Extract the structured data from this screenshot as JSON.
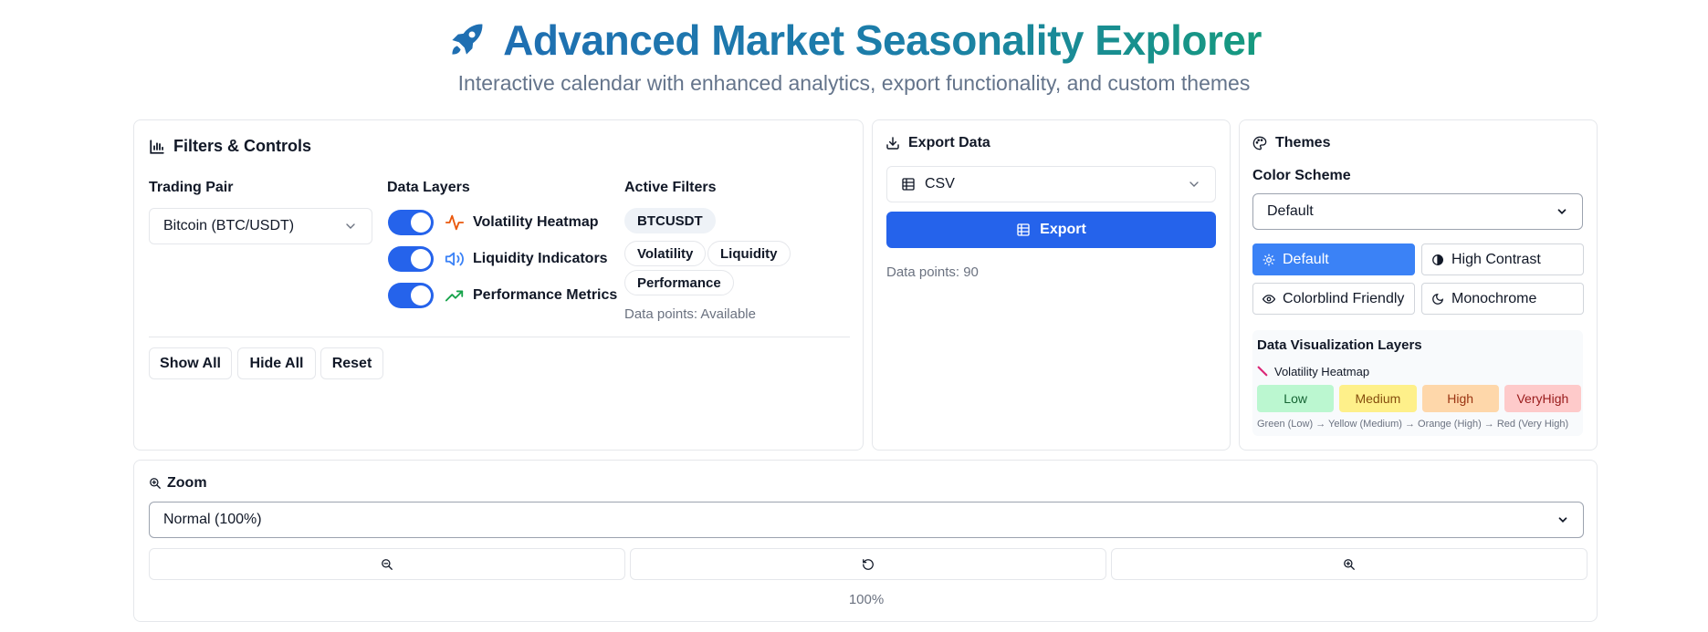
{
  "header": {
    "title": "Advanced Market Seasonality Explorer",
    "subtitle": "Interactive calendar with enhanced analytics, export functionality, and custom themes",
    "icon": "rocket-icon"
  },
  "filters": {
    "title": "Filters & Controls",
    "trading_pair_label": "Trading Pair",
    "trading_pair_value": "Bitcoin (BTC/USDT)",
    "data_layers_label": "Data Layers",
    "layers": [
      {
        "label": "Volatility Heatmap",
        "icon": "activity-icon",
        "on": true
      },
      {
        "label": "Liquidity Indicators",
        "icon": "volume-icon",
        "on": true
      },
      {
        "label": "Performance Metrics",
        "icon": "trending-up-icon",
        "on": true
      }
    ],
    "active_filters_label": "Active Filters",
    "active_symbol": "BTCUSDT",
    "active_tags": [
      "Volatility",
      "Liquidity",
      "Performance"
    ],
    "data_points_status": "Data points: Available",
    "buttons": {
      "show_all": "Show All",
      "hide_all": "Hide All",
      "reset": "Reset"
    }
  },
  "export": {
    "title": "Export Data",
    "format": "CSV",
    "button": "Export",
    "data_points": "Data points: 90"
  },
  "themes": {
    "title": "Themes",
    "color_scheme_label": "Color Scheme",
    "color_scheme_value": "Default",
    "options": [
      {
        "label": "Default",
        "icon": "sun-icon",
        "active": true
      },
      {
        "label": "High Contrast",
        "icon": "contrast-icon",
        "active": false
      },
      {
        "label": "Colorblind Friendly",
        "icon": "eye-icon",
        "active": false
      },
      {
        "label": "Monochrome",
        "icon": "moon-icon",
        "active": false
      }
    ],
    "viz_title": "Data Visualization Layers",
    "viz_layer": "Volatility Heatmap",
    "levels": [
      {
        "label": "Low",
        "bg": "#bbf7d0",
        "fg": "#166534"
      },
      {
        "label": "Medium",
        "bg": "#fef08a",
        "fg": "#854d0e"
      },
      {
        "label": "High",
        "bg": "#fed7aa",
        "fg": "#9a3412"
      },
      {
        "label": "VeryHigh",
        "bg": "#fecaca",
        "fg": "#991b1b"
      }
    ],
    "legend_text": "Green (Low) → Yellow (Medium) → Orange (High) → Red (Very High)"
  },
  "zoom": {
    "title": "Zoom",
    "select_value": "Normal (100%)",
    "level": "100%"
  },
  "colors": {
    "primary": "#2563eb",
    "title_gradient_start": "#1f6fb2",
    "title_gradient_end": "#169a7e"
  }
}
